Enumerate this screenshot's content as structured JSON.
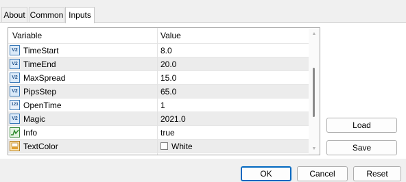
{
  "tabs": [
    {
      "label": "About"
    },
    {
      "label": "Common"
    },
    {
      "label": "Inputs"
    }
  ],
  "active_tab": "Inputs",
  "grid": {
    "headers": {
      "variable": "Variable",
      "value": "Value"
    },
    "rows": [
      {
        "name": "TimeStart",
        "value": "8.0",
        "icon": "double-value-icon",
        "glyph": "V2"
      },
      {
        "name": "TimeEnd",
        "value": "20.0",
        "icon": "double-value-icon",
        "glyph": "V2"
      },
      {
        "name": "MaxSpread",
        "value": "15.0",
        "icon": "double-value-icon",
        "glyph": "V2"
      },
      {
        "name": "PipsStep",
        "value": "65.0",
        "icon": "double-value-icon",
        "glyph": "V2"
      },
      {
        "name": "OpenTime",
        "value": "1",
        "icon": "integer-value-icon",
        "glyph": "123"
      },
      {
        "name": "Magic",
        "value": "2021.0",
        "icon": "double-value-icon",
        "glyph": "V2"
      },
      {
        "name": "Info",
        "value": "true",
        "icon": "bool-value-icon",
        "glyph": ""
      },
      {
        "name": "TextColor",
        "value": "White",
        "icon": "color-value-icon",
        "glyph": ""
      }
    ]
  },
  "side_buttons": {
    "load": "Load",
    "save": "Save"
  },
  "footer_buttons": {
    "ok": "OK",
    "cancel": "Cancel",
    "reset": "Reset"
  },
  "colors": {
    "default_button_border": "#0067c0",
    "swatch": "#ffffff"
  }
}
